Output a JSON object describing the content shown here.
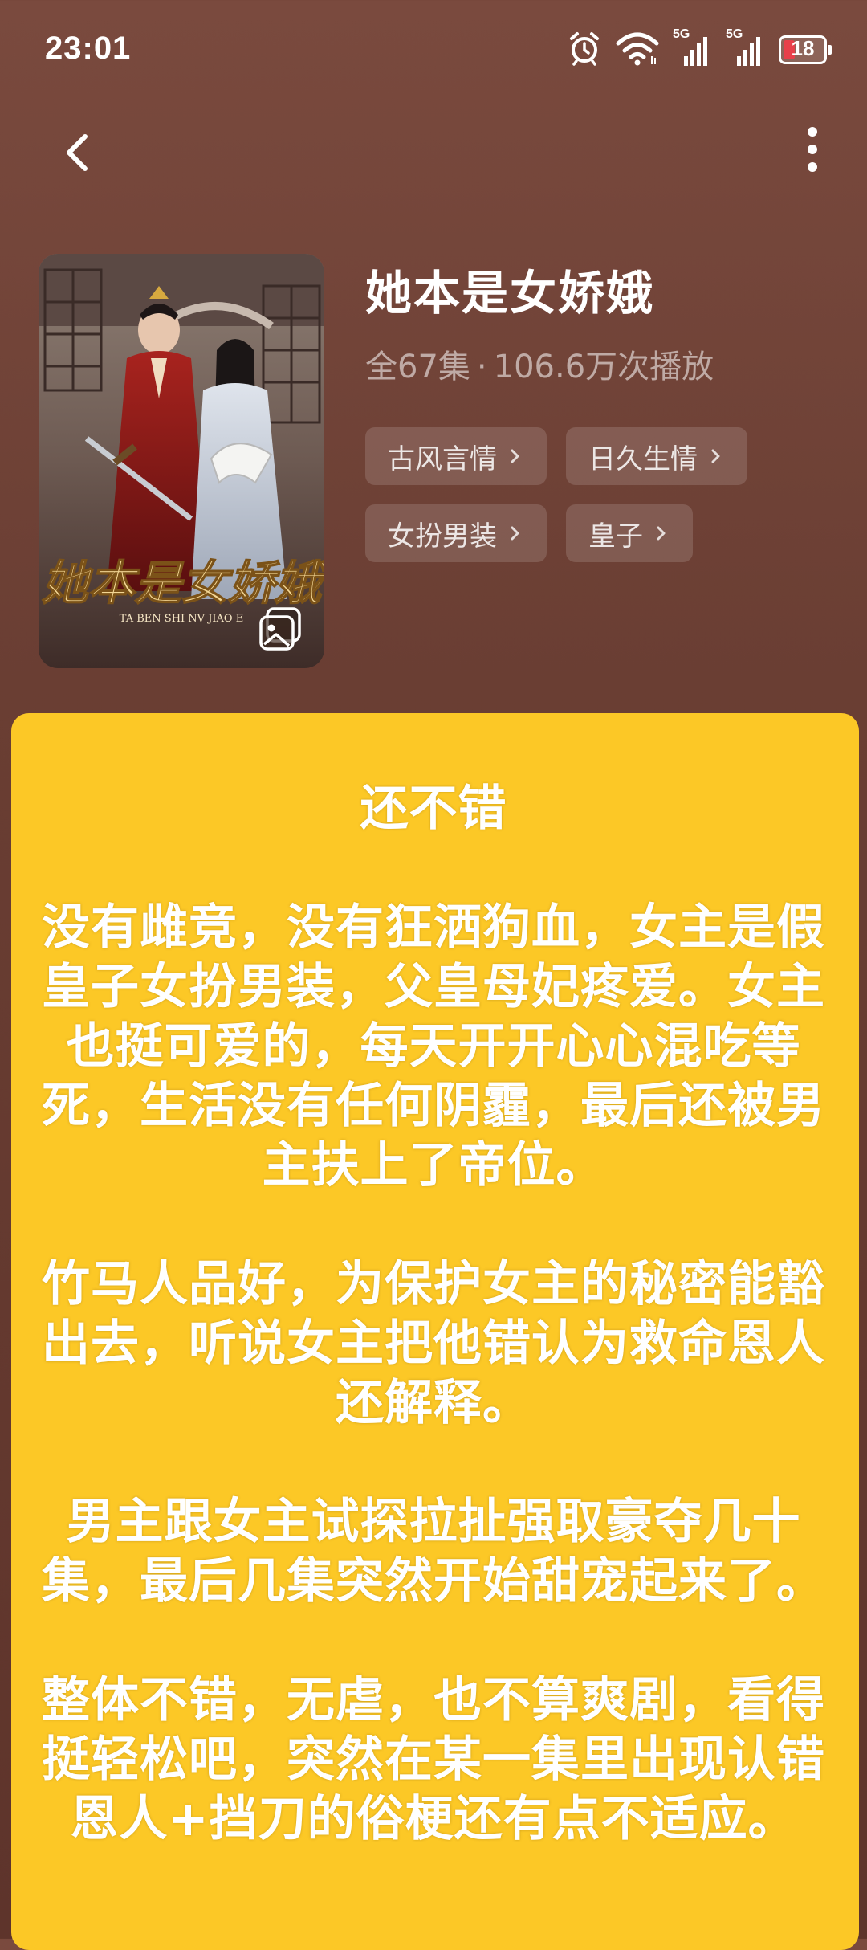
{
  "status_bar": {
    "time": "23:01",
    "network_1": "5G",
    "network_2": "5G",
    "battery": "18",
    "icons": [
      "alarm-icon",
      "wifi-icon",
      "signal-5g-icon",
      "signal-5g-icon",
      "battery-icon"
    ],
    "battery_color": "#e8404a"
  },
  "nav": {
    "back_icon": "chevron-left-icon",
    "more_icon": "more-vertical-icon"
  },
  "drama": {
    "title": "她本是女娇娥",
    "episodes": "全67集",
    "separator": "·",
    "plays": "106.6万次播放",
    "poster_title": "她本是女娇娥",
    "poster_subtitle": "TA BEN SHI NV JIAO E",
    "tags": [
      {
        "label": "古风言情"
      },
      {
        "label": "日久生情"
      },
      {
        "label": "女扮男装"
      },
      {
        "label": "皇子"
      }
    ]
  },
  "review": {
    "background": "#fcc826",
    "heading": "还不错",
    "paragraphs": [
      [
        "没有雌竞，没有狂洒狗血，女主是假",
        "皇子女扮男装，父皇母妃疼爱。女主",
        "也挺可爱的，每天开开心心混吃等",
        "死，生活没有任何阴霾，最后还被男",
        "主扶上了帝位。"
      ],
      [
        "竹马人品好，为保护女主的秘密能豁",
        "出去，听说女主把他错认为救命恩人",
        "还解释。"
      ],
      [
        "男主跟女主试探拉扯强取豪夺几十",
        "集，最后几集突然开始甜宠起来了。"
      ],
      [
        "整体不错，无虐，也不算爽剧，看得",
        "挺轻松吧，突然在某一集里出现认错",
        "恩人+挡刀的俗梗还有点不适应。"
      ]
    ]
  }
}
